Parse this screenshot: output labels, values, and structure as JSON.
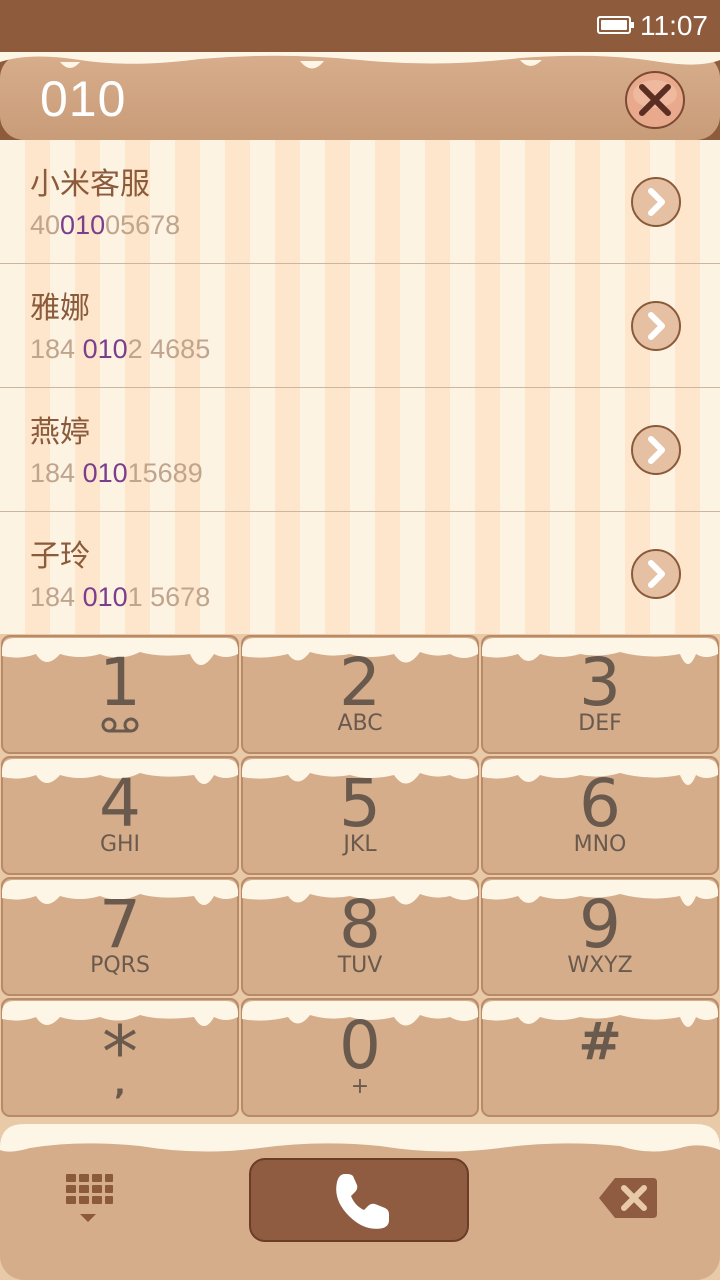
{
  "status_bar": {
    "time": "11:07",
    "battery_icon": "battery-icon"
  },
  "search": {
    "entered_number": "010",
    "clear_icon": "close-icon"
  },
  "contacts": [
    {
      "name": "小米客服",
      "number_parts": [
        "40",
        "010",
        "05678"
      ]
    },
    {
      "name": "雅娜",
      "number_parts": [
        "184 ",
        "010",
        "2 4685"
      ]
    },
    {
      "name": "燕婷",
      "number_parts": [
        "184 ",
        "010",
        "15689"
      ]
    },
    {
      "name": "子玲",
      "number_parts": [
        "184 ",
        "010",
        "1 5678"
      ]
    }
  ],
  "keypad": {
    "keys": [
      {
        "digit": "1",
        "letters": "",
        "icon": "voicemail-icon"
      },
      {
        "digit": "2",
        "letters": "ABC"
      },
      {
        "digit": "3",
        "letters": "DEF"
      },
      {
        "digit": "4",
        "letters": "GHI"
      },
      {
        "digit": "5",
        "letters": "JKL"
      },
      {
        "digit": "6",
        "letters": "MNO"
      },
      {
        "digit": "7",
        "letters": "PQRS"
      },
      {
        "digit": "8",
        "letters": "TUV"
      },
      {
        "digit": "9",
        "letters": "WXYZ"
      },
      {
        "digit": "*",
        "letters": ","
      },
      {
        "digit": "0",
        "letters": "+"
      },
      {
        "digit": "#",
        "letters": ""
      }
    ]
  },
  "actions": {
    "dialpad_icon": "dialpad-icon",
    "call_icon": "phone-icon",
    "backspace_icon": "backspace-icon"
  },
  "colors": {
    "chocolate": "#8e5b3c",
    "cream": "#fdf3e3",
    "key_tan": "#d5ad8b",
    "highlight": "#7b3e8c"
  }
}
